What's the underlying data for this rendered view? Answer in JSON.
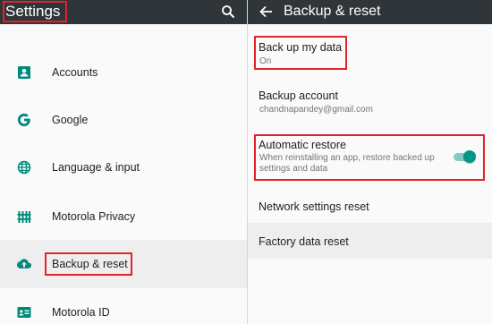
{
  "left": {
    "title": "Settings",
    "items": [
      {
        "label": "Accounts",
        "icon": "accounts-icon"
      },
      {
        "label": "Google",
        "icon": "google-icon"
      },
      {
        "label": "Language & input",
        "icon": "globe-icon"
      },
      {
        "label": "Motorola Privacy",
        "icon": "privacy-icon"
      },
      {
        "label": "Backup & reset",
        "icon": "cloud-upload-icon",
        "selected": true
      },
      {
        "label": "Motorola ID",
        "icon": "id-card-icon"
      }
    ]
  },
  "right": {
    "title": "Backup & reset",
    "backup_data": {
      "title": "Back up my data",
      "summary": "On"
    },
    "backup_account": {
      "title": "Backup account",
      "summary": "chandnapandey@gmail.com"
    },
    "auto_restore": {
      "title": "Automatic restore",
      "summary": "When reinstalling an app, restore backed up settings and data",
      "enabled": true
    },
    "network_reset": {
      "title": "Network settings reset"
    },
    "factory_reset": {
      "title": "Factory data reset"
    }
  },
  "colors": {
    "toolbar": "#2f3538",
    "accent": "#009688",
    "highlight": "#e0242a",
    "selected_bg": "#eeeeee"
  }
}
